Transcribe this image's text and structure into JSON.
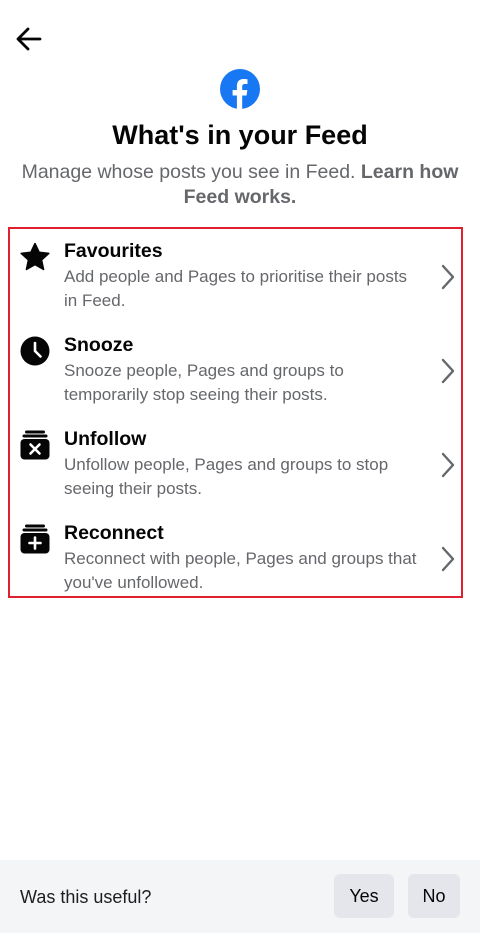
{
  "header": {
    "back_icon": "arrow-left-icon",
    "logo_icon": "facebook-logo-icon",
    "brand_color": "#1877f2"
  },
  "intro": {
    "title": "What's in your Feed",
    "subtitle": "Manage whose posts you see in Feed.",
    "learn_link": "Learn how Feed works."
  },
  "options": [
    {
      "title": "Favourites",
      "description": "Add people and Pages to prioritise their posts in Feed.",
      "icon": "star-icon"
    },
    {
      "title": "Snooze",
      "description": "Snooze people, Pages and groups to temporarily stop seeing their posts.",
      "icon": "clock-icon"
    },
    {
      "title": "Unfollow",
      "description": "Unfollow people, Pages and groups to stop seeing their posts.",
      "icon": "unfollow-icon"
    },
    {
      "title": "Reconnect",
      "description": "Reconnect with people, Pages and groups that you've unfollowed.",
      "icon": "reconnect-icon"
    }
  ],
  "highlight_color": "#e0202e",
  "footer": {
    "question": "Was this useful?",
    "yes_label": "Yes",
    "no_label": "No"
  }
}
